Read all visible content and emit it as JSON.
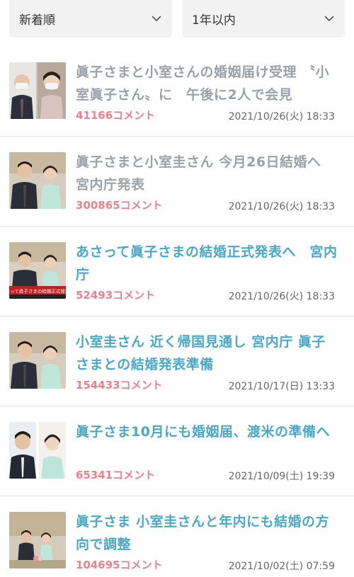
{
  "filters": {
    "sort_label": "新着順",
    "range_label": "1年以内"
  },
  "articles": [
    {
      "title": "眞子さまと小室さんの婚姻届け受理 〝小室眞子さん〟に　午後に2人で会見",
      "comments": "41166コメント",
      "date": "2021/10/26(火) 18:33",
      "thumb": "thumb-masked"
    },
    {
      "title": "眞子さまと小室圭さん 今月26日結婚へ 宮内庁発表",
      "comments": "300865コメント",
      "date": "2021/10/26(火) 18:33",
      "thumb": "thumb-couple"
    },
    {
      "title": "あさって眞子さまの結婚正式発表へ　宮内庁",
      "comments": "52493コメント",
      "date": "2021/10/26(火) 18:33",
      "thumb": "thumb-news",
      "caption": "さって眞子さまの結婚正式発表"
    },
    {
      "title": "小室圭さん 近く帰国見通し 宮内庁 眞子さまとの結婚発表準備",
      "comments": "154433コメント",
      "date": "2021/10/17(日) 13:33",
      "thumb": "thumb-couple"
    },
    {
      "title": "眞子さま10月にも婚姻届、渡米の準備へ",
      "comments": "65341コメント",
      "date": "2021/10/09(土) 19:39",
      "thumb": "thumb-split"
    },
    {
      "title": "眞子さま 小室圭さんと年内にも結婚の方向で調整",
      "comments": "104695コメント",
      "date": "2021/10/02(土) 07:59",
      "thumb": "thumb-wide"
    }
  ],
  "colors": {
    "title_read": "#9aa1a8",
    "title_unread": "#4aa8c4",
    "comments": "#ee7f8c",
    "filter_bg": "#f2f2f2"
  }
}
